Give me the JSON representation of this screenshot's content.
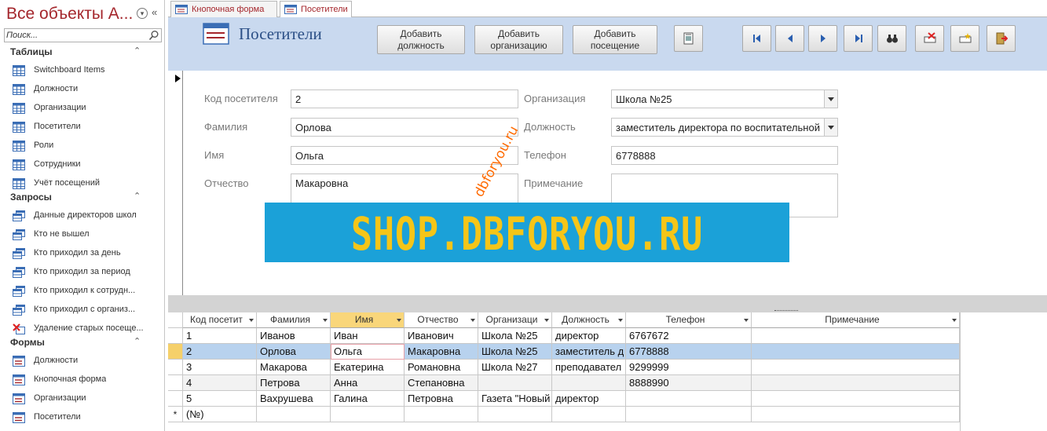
{
  "nav": {
    "title": "Все объекты A...",
    "search_placeholder": "Поиск...",
    "groups": [
      {
        "title": "Таблицы",
        "items": [
          {
            "label": "Switchboard Items",
            "icon": "table-icon"
          },
          {
            "label": "Должности",
            "icon": "table-icon"
          },
          {
            "label": "Организации",
            "icon": "table-icon"
          },
          {
            "label": "Посетители",
            "icon": "table-icon"
          },
          {
            "label": "Роли",
            "icon": "table-icon"
          },
          {
            "label": "Сотрудники",
            "icon": "table-icon"
          },
          {
            "label": "Учёт посещений",
            "icon": "table-icon"
          }
        ]
      },
      {
        "title": "Запросы",
        "items": [
          {
            "label": "Данные директоров школ",
            "icon": "query-icon"
          },
          {
            "label": "Кто не вышел",
            "icon": "query-icon"
          },
          {
            "label": "Кто приходил за день",
            "icon": "query-icon"
          },
          {
            "label": "Кто приходил за период",
            "icon": "query-icon"
          },
          {
            "label": "Кто приходил к сотрудн...",
            "icon": "query-icon"
          },
          {
            "label": "Кто приходил с организ...",
            "icon": "query-icon"
          },
          {
            "label": "Удаление старых посеще...",
            "icon": "delete-query-icon"
          }
        ]
      },
      {
        "title": "Формы",
        "items": [
          {
            "label": "Должности",
            "icon": "form-icon"
          },
          {
            "label": "Кнопочная форма",
            "icon": "form-icon"
          },
          {
            "label": "Организации",
            "icon": "form-icon"
          },
          {
            "label": "Посетители",
            "icon": "form-icon"
          }
        ]
      }
    ]
  },
  "tabs": [
    {
      "label": "Кнопочная форма",
      "active": false
    },
    {
      "label": "Посетители",
      "active": true
    }
  ],
  "header": {
    "title": "Посетители",
    "buttons": [
      {
        "line1": "Добавить",
        "line2": "должность"
      },
      {
        "line1": "Добавить",
        "line2": "организацию"
      },
      {
        "line1": "Добавить",
        "line2": "посещение"
      }
    ],
    "icon_buttons": [
      "report-icon",
      "first-record-icon",
      "previous-record-icon",
      "next-record-icon",
      "last-record-icon",
      "find-icon",
      "delete-record-icon",
      "new-record-icon",
      "close-form-icon"
    ]
  },
  "form": {
    "labels": {
      "code": "Код посетителя",
      "surname": "Фамилия",
      "name": "Имя",
      "patronymic": "Отчество",
      "organization": "Организация",
      "position": "Должность",
      "phone": "Телефон",
      "note": "Примечание"
    },
    "values": {
      "code": "2",
      "surname": "Орлова",
      "name": "Ольга",
      "patronymic": "Макаровна",
      "organization": "Школа №25",
      "position": "заместитель директора по воспитательной",
      "phone": "6778888",
      "note": ""
    }
  },
  "watermark": {
    "banner": "SHOP.DBFORYOU.RU",
    "diagonal": "dbforyou.ru"
  },
  "datasheet": {
    "columns": [
      "Код посетит",
      "Фамилия",
      "Имя",
      "Отчество",
      "Организаци",
      "Должность",
      "Телефон",
      "Примечание"
    ],
    "sorted_column": "Имя",
    "rows": [
      [
        "1",
        "Иванов",
        "Иван",
        "Иванович",
        "Школа №25",
        "директор",
        "6767672",
        ""
      ],
      [
        "2",
        "Орлова",
        "Ольга",
        "Макаровна",
        "Школа №25",
        "заместитель д",
        "6778888",
        ""
      ],
      [
        "3",
        "Макарова",
        "Екатерина",
        "Романовна",
        "Школа №27",
        "преподавател",
        "9299999",
        ""
      ],
      [
        "4",
        "Петрова",
        "Анна",
        "Степановна",
        "",
        "",
        "8888990",
        ""
      ],
      [
        "5",
        "Вахрушева",
        "Галина",
        "Петровна",
        "Газета \"Новый",
        "директор",
        "",
        ""
      ]
    ],
    "new_row_marker": "*",
    "new_row_value": "(№)",
    "current_row": 1
  }
}
